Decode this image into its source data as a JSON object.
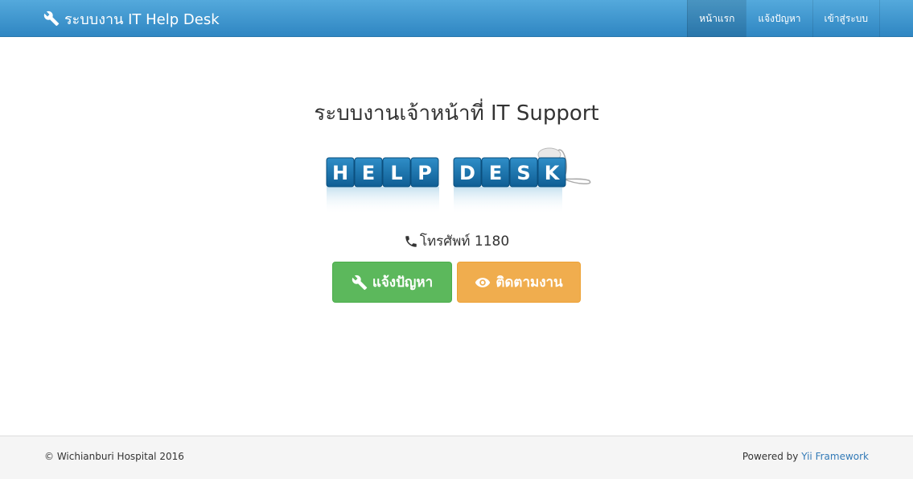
{
  "navbar": {
    "brand": "ระบบงาน IT Help Desk",
    "items": [
      {
        "label": "หน้าแรก",
        "active": true
      },
      {
        "label": "แจ้งปัญหา",
        "active": false
      },
      {
        "label": "เข้าสู่ระบบ",
        "active": false
      }
    ]
  },
  "main": {
    "title": "ระบบงานเจ้าหน้าที่ IT Support",
    "logo_letters": [
      "H",
      "E",
      "L",
      "P",
      "D",
      "E",
      "S",
      "K"
    ],
    "phone": "โทรศัพท์ 1180",
    "buttons": {
      "report_label": "แจ้งปัญหา",
      "track_label": "ติดตามงาน"
    }
  },
  "footer": {
    "copyright": "© Wichianburi Hospital 2016",
    "powered_prefix": "Powered by ",
    "powered_link": "Yii Framework"
  },
  "icons": {
    "brand": "wrench-icon",
    "phone": "phone-icon",
    "report": "wrench-icon",
    "track": "eye-icon"
  },
  "colors": {
    "navbar": "#3a95d0",
    "success": "#5cb85c",
    "warning": "#f0ad4e",
    "link": "#337ab7"
  }
}
